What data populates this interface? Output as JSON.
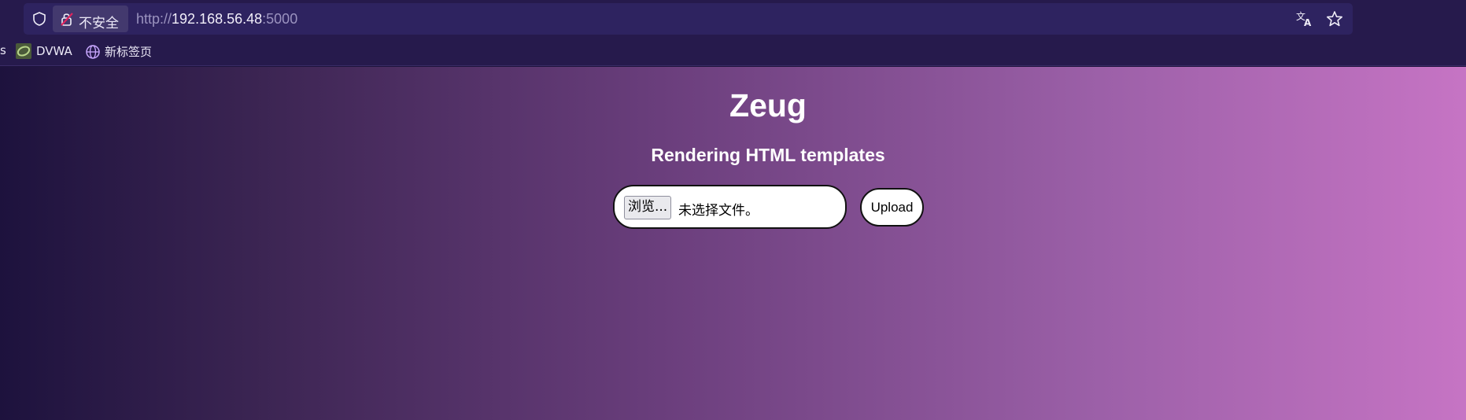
{
  "browser": {
    "insecure_label": "不安全",
    "url": {
      "scheme": "http://",
      "host": "192.168.56.48",
      "port": ":5000"
    },
    "bookmarks": [
      {
        "label": "s",
        "icon": "truncated"
      },
      {
        "label": "DVWA",
        "icon": "dvwa-icon"
      },
      {
        "label": "新标签页",
        "icon": "globe-icon"
      }
    ]
  },
  "page": {
    "title": "Zeug",
    "subtitle": "Rendering HTML templates",
    "file_input": {
      "browse_label": "浏览...",
      "no_file_label": "未选择文件。"
    },
    "upload_label": "Upload"
  },
  "colors": {
    "chrome_bg": "#261a4c",
    "urlbar_bg": "#2e2360",
    "gradient_start": "#1d123d",
    "gradient_end": "#c674c4"
  }
}
